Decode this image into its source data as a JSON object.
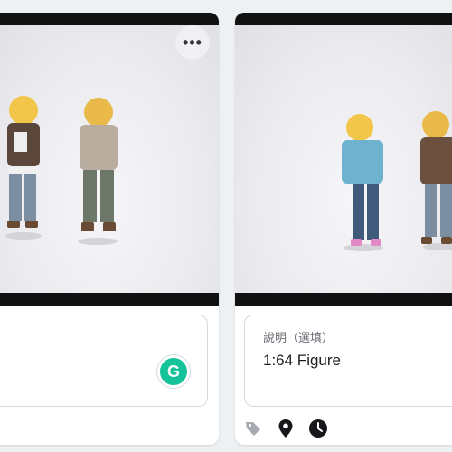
{
  "cards": [
    {
      "more_label": "•••",
      "caption": {
        "label": "",
        "value": ""
      },
      "grammarly_letter": "G"
    },
    {
      "caption": {
        "label": "說明（選填）",
        "value": "1:64 Figure"
      },
      "icons": [
        "tag-icon",
        "location-pin-icon",
        "clock-icon"
      ]
    }
  ],
  "colors": {
    "background": "#eef1f4",
    "grammarly": "#15c39a",
    "frame": "#111111"
  }
}
